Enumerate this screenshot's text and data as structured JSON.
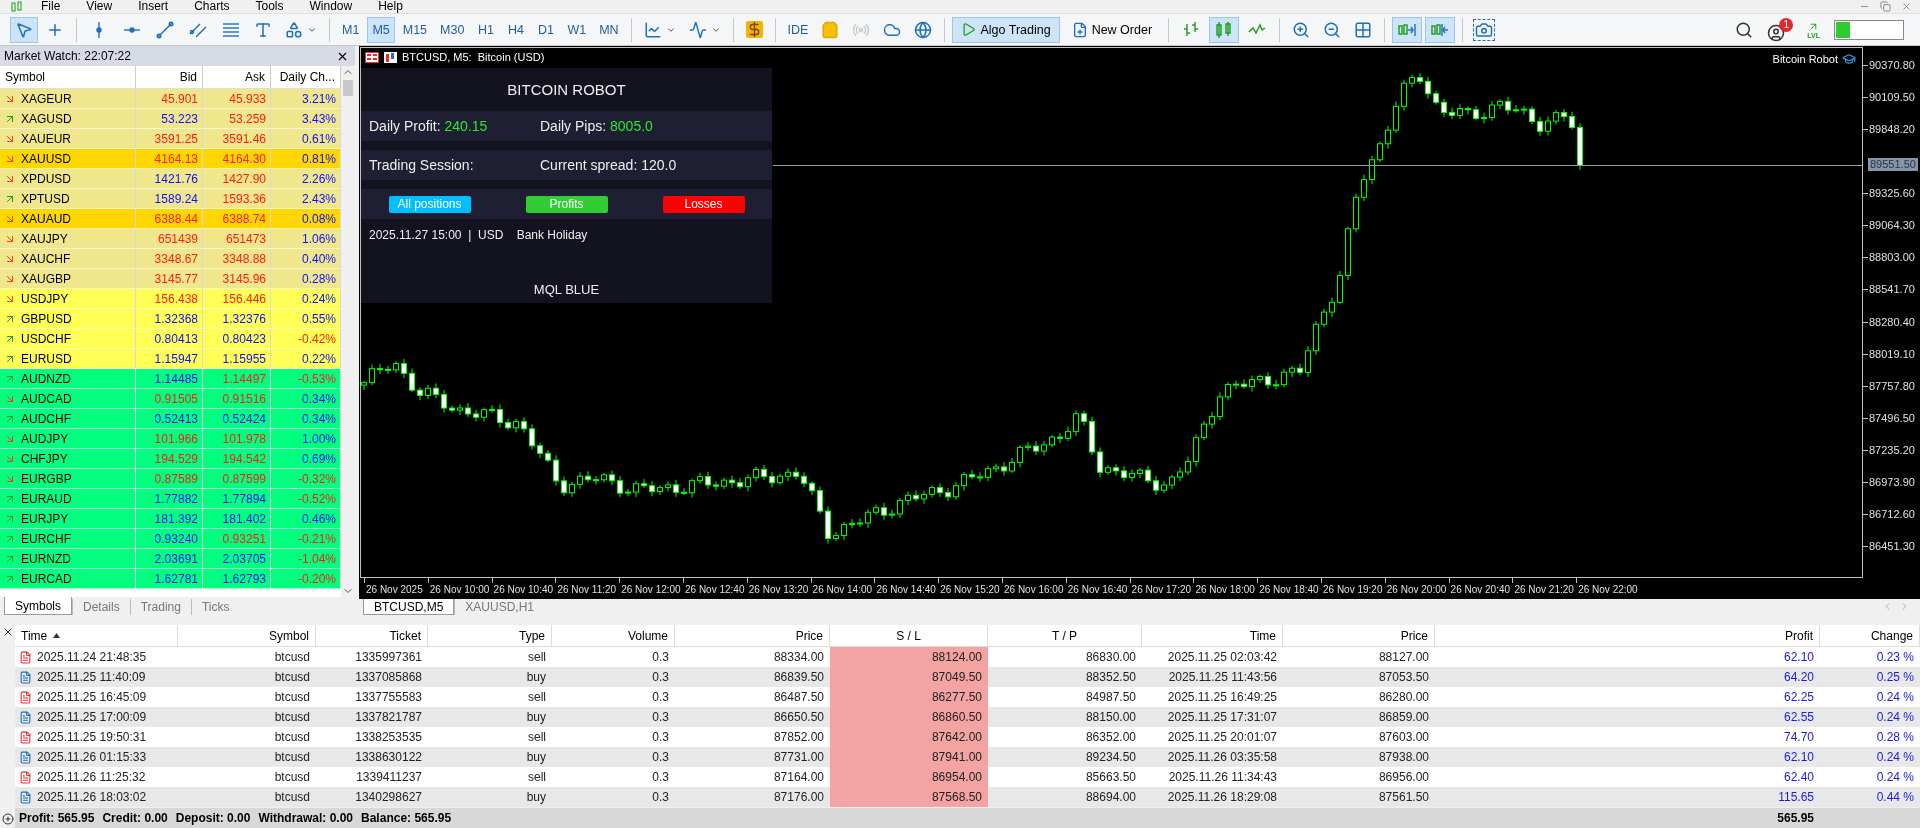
{
  "menu": {
    "items": [
      "File",
      "View",
      "Insert",
      "Charts",
      "Tools",
      "Window",
      "Help"
    ]
  },
  "toolbar": {
    "items": [
      {
        "kind": "icon",
        "pressed": true,
        "disabled": false
      },
      {
        "kind": "icon",
        "pressed": false,
        "disabled": false
      },
      {
        "kind": "separator"
      },
      {
        "kind": "icon",
        "pressed": false,
        "disabled": false
      },
      {
        "kind": "icon",
        "pressed": false,
        "disabled": false
      },
      {
        "kind": "icon",
        "pressed": false,
        "disabled": false
      },
      {
        "kind": "icon",
        "pressed": false,
        "disabled": false
      },
      {
        "kind": "icon",
        "pressed": false,
        "disabled": false
      },
      {
        "kind": "icon",
        "pressed": false,
        "disabled": false
      },
      {
        "kind": "icon",
        "pressed": false,
        "disabled": false
      },
      {
        "kind": "separator"
      },
      {
        "kind": "text",
        "label": "M1",
        "pressed": false
      },
      {
        "kind": "text",
        "label": "M5",
        "pressed": true
      },
      {
        "kind": "text",
        "label": "M15",
        "pressed": false
      },
      {
        "kind": "text",
        "label": "M30",
        "pressed": false
      },
      {
        "kind": "text",
        "label": "H1",
        "pressed": false
      },
      {
        "kind": "text",
        "label": "H4",
        "pressed": false
      },
      {
        "kind": "text",
        "label": "D1",
        "pressed": false
      },
      {
        "kind": "text",
        "label": "W1",
        "pressed": false
      },
      {
        "kind": "text",
        "label": "MN",
        "pressed": false
      },
      {
        "kind": "separator"
      },
      {
        "kind": "icon",
        "pressed": false,
        "disabled": false
      },
      {
        "kind": "icon",
        "pressed": false,
        "disabled": false
      },
      {
        "kind": "separator"
      },
      {
        "kind": "icon",
        "pressed": false,
        "disabled": false
      },
      {
        "kind": "separator"
      },
      {
        "kind": "text",
        "label": "IDE",
        "pressed": false
      },
      {
        "kind": "icon",
        "pressed": false,
        "disabled": false
      },
      {
        "kind": "icon",
        "pressed": false,
        "disabled": true
      },
      {
        "kind": "icon",
        "pressed": false,
        "disabled": false
      },
      {
        "kind": "icon",
        "pressed": false,
        "disabled": false
      },
      {
        "kind": "separator"
      },
      {
        "kind": "button",
        "label": "Algo Trading",
        "pressed": true
      },
      {
        "kind": "button",
        "label": "New Order",
        "pressed": false
      },
      {
        "kind": "separator"
      },
      {
        "kind": "icon",
        "pressed": false,
        "disabled": false
      },
      {
        "kind": "icon",
        "pressed": true,
        "disabled": false
      },
      {
        "kind": "icon",
        "pressed": false,
        "disabled": false
      },
      {
        "kind": "separator"
      },
      {
        "kind": "icon",
        "pressed": false,
        "disabled": false
      },
      {
        "kind": "icon",
        "pressed": false,
        "disabled": false
      },
      {
        "kind": "icon",
        "pressed": false,
        "disabled": false
      },
      {
        "kind": "separator"
      },
      {
        "kind": "icon",
        "pressed": true,
        "disabled": false
      },
      {
        "kind": "icon",
        "pressed": true,
        "disabled": false
      },
      {
        "kind": "separator"
      },
      {
        "kind": "icon",
        "pressed": false,
        "disabled": false
      }
    ],
    "notification_count": "1",
    "level_label": "LVL"
  },
  "market_watch": {
    "title": "Market Watch: 22:07:22",
    "columns": [
      "Symbol",
      "Bid",
      "Ask",
      "Daily Ch..."
    ],
    "rows": [
      {
        "symbol": "XAGEUR",
        "rising": false,
        "bid": "45.901",
        "bid_up": false,
        "ask": "45.933",
        "ask_up": false,
        "change": "3.21%",
        "change_up": true,
        "color": "#f0e68c"
      },
      {
        "symbol": "XAGUSD",
        "rising": true,
        "bid": "53.223",
        "bid_up": true,
        "ask": "53.259",
        "ask_up": false,
        "change": "3.43%",
        "change_up": true,
        "color": "#f0e68c"
      },
      {
        "symbol": "XAUEUR",
        "rising": false,
        "bid": "3591.25",
        "bid_up": false,
        "ask": "3591.46",
        "ask_up": false,
        "change": "0.61%",
        "change_up": true,
        "color": "#f0e68c"
      },
      {
        "symbol": "XAUUSD",
        "rising": false,
        "bid": "4164.13",
        "bid_up": false,
        "ask": "4164.30",
        "ask_up": false,
        "change": "0.81%",
        "change_up": true,
        "color": "#ffd700"
      },
      {
        "symbol": "XPDUSD",
        "rising": false,
        "bid": "1421.76",
        "bid_up": true,
        "ask": "1427.90",
        "ask_up": false,
        "change": "2.26%",
        "change_up": true,
        "color": "#f0e68c"
      },
      {
        "symbol": "XPTUSD",
        "rising": true,
        "bid": "1589.24",
        "bid_up": true,
        "ask": "1593.36",
        "ask_up": false,
        "change": "2.43%",
        "change_up": true,
        "color": "#f0e68c"
      },
      {
        "symbol": "XAUAUD",
        "rising": false,
        "bid": "6388.44",
        "bid_up": false,
        "ask": "6388.74",
        "ask_up": false,
        "change": "0.08%",
        "change_up": true,
        "color": "#ffd700"
      },
      {
        "symbol": "XAUJPY",
        "rising": false,
        "bid": "651439",
        "bid_up": false,
        "ask": "651473",
        "ask_up": false,
        "change": "1.06%",
        "change_up": true,
        "color": "#f0e68c"
      },
      {
        "symbol": "XAUCHF",
        "rising": false,
        "bid": "3348.67",
        "bid_up": false,
        "ask": "3348.88",
        "ask_up": false,
        "change": "0.40%",
        "change_up": true,
        "color": "#f0e68c"
      },
      {
        "symbol": "XAUGBP",
        "rising": false,
        "bid": "3145.77",
        "bid_up": false,
        "ask": "3145.96",
        "ask_up": false,
        "change": "0.28%",
        "change_up": true,
        "color": "#f0e68c"
      },
      {
        "symbol": "USDJPY",
        "rising": false,
        "bid": "156.438",
        "bid_up": false,
        "ask": "156.446",
        "ask_up": false,
        "change": "0.24%",
        "change_up": true,
        "color": "#ffff55"
      },
      {
        "symbol": "GBPUSD",
        "rising": true,
        "bid": "1.32368",
        "bid_up": true,
        "ask": "1.32376",
        "ask_up": true,
        "change": "0.55%",
        "change_up": true,
        "color": "#ffff55"
      },
      {
        "symbol": "USDCHF",
        "rising": true,
        "bid": "0.80413",
        "bid_up": true,
        "ask": "0.80423",
        "ask_up": true,
        "change": "-0.42%",
        "change_up": false,
        "color": "#ffff55"
      },
      {
        "symbol": "EURUSD",
        "rising": true,
        "bid": "1.15947",
        "bid_up": true,
        "ask": "1.15955",
        "ask_up": true,
        "change": "0.22%",
        "change_up": true,
        "color": "#ffff55"
      },
      {
        "symbol": "AUDNZD",
        "rising": true,
        "bid": "1.14485",
        "bid_up": true,
        "ask": "1.14497",
        "ask_up": false,
        "change": "-0.53%",
        "change_up": false,
        "color": "#00ff7f"
      },
      {
        "symbol": "AUDCAD",
        "rising": false,
        "bid": "0.91505",
        "bid_up": false,
        "ask": "0.91516",
        "ask_up": false,
        "change": "0.34%",
        "change_up": true,
        "color": "#00ff7f"
      },
      {
        "symbol": "AUDCHF",
        "rising": true,
        "bid": "0.52413",
        "bid_up": true,
        "ask": "0.52424",
        "ask_up": true,
        "change": "0.34%",
        "change_up": true,
        "color": "#00ff7f"
      },
      {
        "symbol": "AUDJPY",
        "rising": false,
        "bid": "101.966",
        "bid_up": false,
        "ask": "101.978",
        "ask_up": false,
        "change": "1.00%",
        "change_up": true,
        "color": "#00ff7f"
      },
      {
        "symbol": "CHFJPY",
        "rising": false,
        "bid": "194.529",
        "bid_up": false,
        "ask": "194.542",
        "ask_up": false,
        "change": "0.69%",
        "change_up": true,
        "color": "#00ff7f"
      },
      {
        "symbol": "EURGBP",
        "rising": false,
        "bid": "0.87589",
        "bid_up": false,
        "ask": "0.87599",
        "ask_up": false,
        "change": "-0.32%",
        "change_up": false,
        "color": "#00ff7f"
      },
      {
        "symbol": "EURAUD",
        "rising": true,
        "bid": "1.77882",
        "bid_up": true,
        "ask": "1.77894",
        "ask_up": true,
        "change": "-0.52%",
        "change_up": false,
        "color": "#00ff7f"
      },
      {
        "symbol": "EURJPY",
        "rising": true,
        "bid": "181.392",
        "bid_up": true,
        "ask": "181.402",
        "ask_up": true,
        "change": "0.46%",
        "change_up": true,
        "color": "#00ff7f"
      },
      {
        "symbol": "EURCHF",
        "rising": true,
        "bid": "0.93240",
        "bid_up": true,
        "ask": "0.93251",
        "ask_up": false,
        "change": "-0.21%",
        "change_up": false,
        "color": "#00ff7f"
      },
      {
        "symbol": "EURNZD",
        "rising": true,
        "bid": "2.03691",
        "bid_up": true,
        "ask": "2.03705",
        "ask_up": true,
        "change": "-1.04%",
        "change_up": false,
        "color": "#00ff7f"
      },
      {
        "symbol": "EURCAD",
        "rising": true,
        "bid": "1.62781",
        "bid_up": true,
        "ask": "1.62793",
        "ask_up": true,
        "change": "-0.20%",
        "change_up": false,
        "color": "#00ff7f"
      }
    ],
    "tabs": [
      {
        "label": "Symbols",
        "selected": true
      },
      {
        "label": "Details",
        "selected": false
      },
      {
        "label": "Trading",
        "selected": false
      },
      {
        "label": "Ticks",
        "selected": false
      }
    ]
  },
  "chart": {
    "header": "BTCUSD, M5:  Bitcoin (USD)",
    "expert": "Bitcoin Robot",
    "price_axis": [
      "90370.80",
      "90109.50",
      "89848.20",
      "89325.60",
      "89064.30",
      "88803.00",
      "88541.70",
      "88280.40",
      "88019.10",
      "87757.80",
      "87496.50",
      "87235.20",
      "86973.90",
      "86712.60",
      "86451.30"
    ],
    "current_price": "89551.50",
    "time_axis": [
      "26 Nov 2025",
      "26 Nov 10:00",
      "26 Nov 10:40",
      "26 Nov 11:20",
      "26 Nov 12:00",
      "26 Nov 12:40",
      "26 Nov 13:20",
      "26 Nov 14:00",
      "26 Nov 14:40",
      "26 Nov 15:20",
      "26 Nov 16:00",
      "26 Nov 16:40",
      "26 Nov 17:20",
      "26 Nov 18:00",
      "26 Nov 18:40",
      "26 Nov 19:20",
      "26 Nov 20:00",
      "26 Nov 20:40",
      "26 Nov 21:20",
      "26 Nov 22:00"
    ],
    "panel": {
      "title": "BITCOIN ROBOT",
      "rows": [
        [
          {
            "label": "Daily Profit:",
            "value": "240.15",
            "highlight": true
          },
          {
            "label": "Daily Pips:",
            "value": "8005.0",
            "highlight": true
          }
        ],
        [
          {
            "label": "Trading Session:"
          },
          {
            "label": "Current spread:",
            "value": "120.0",
            "highlight": false
          }
        ]
      ],
      "buttons": [
        {
          "label": "All positions",
          "color": "#00bfff"
        },
        {
          "label": "Profits",
          "color": "#32cd32"
        },
        {
          "label": "Losses",
          "color": "#ff0000"
        }
      ],
      "news": {
        "date": "2025.11.27 15:00",
        "separator": "|",
        "currency": "USD",
        "event": "Bank Holiday"
      },
      "footer": "MQL BLUE"
    },
    "tabs": [
      {
        "label": "BTCUSD,M5",
        "selected": true
      },
      {
        "label": "XAUUSD,H1",
        "selected": false
      }
    ]
  },
  "trades": {
    "columns": [
      "Time",
      "Symbol",
      "Ticket",
      "Type",
      "Volume",
      "Price",
      "S / L",
      "T / P",
      "Time",
      "Price",
      "Profit",
      "Change"
    ],
    "rows": [
      {
        "kind": "sell",
        "cells": [
          "2025.11.24 21:48:35",
          "btcusd",
          "1335997361",
          "sell",
          "0.3",
          "88334.00",
          "88124.00",
          "86830.00",
          "2025.11.25 02:03:42",
          "88127.00",
          "62.10",
          "0.23 %"
        ]
      },
      {
        "kind": "buy",
        "cells": [
          "2025.11.25 11:40:09",
          "btcusd",
          "1337085868",
          "buy",
          "0.3",
          "86839.50",
          "87049.50",
          "88352.50",
          "2025.11.25 11:43:56",
          "87053.50",
          "64.20",
          "0.25 %"
        ]
      },
      {
        "kind": "sell",
        "cells": [
          "2025.11.25 16:45:09",
          "btcusd",
          "1337755583",
          "sell",
          "0.3",
          "86487.50",
          "86277.50",
          "84987.50",
          "2025.11.25 16:49:25",
          "86280.00",
          "62.25",
          "0.24 %"
        ]
      },
      {
        "kind": "buy",
        "cells": [
          "2025.11.25 17:00:09",
          "btcusd",
          "1337821787",
          "buy",
          "0.3",
          "86650.50",
          "86860.50",
          "88150.00",
          "2025.11.25 17:31:07",
          "86859.00",
          "62.55",
          "0.24 %"
        ]
      },
      {
        "kind": "sell",
        "cells": [
          "2025.11.25 19:50:31",
          "btcusd",
          "1338253535",
          "sell",
          "0.3",
          "87852.00",
          "87642.00",
          "86352.00",
          "2025.11.25 20:01:07",
          "87603.00",
          "74.70",
          "0.28 %"
        ]
      },
      {
        "kind": "buy",
        "cells": [
          "2025.11.26 01:15:33",
          "btcusd",
          "1338630122",
          "buy",
          "0.3",
          "87731.00",
          "87941.00",
          "89234.50",
          "2025.11.26 03:35:58",
          "87938.00",
          "62.10",
          "0.24 %"
        ]
      },
      {
        "kind": "sell",
        "cells": [
          "2025.11.26 11:25:32",
          "btcusd",
          "1339411237",
          "sell",
          "0.3",
          "87164.00",
          "86954.00",
          "85663.50",
          "2025.11.26 11:34:43",
          "86956.00",
          "62.40",
          "0.24 %"
        ]
      },
      {
        "kind": "buy",
        "cells": [
          "2025.11.26 18:03:02",
          "btcusd",
          "1340298627",
          "buy",
          "0.3",
          "87176.00",
          "87568.50",
          "88694.00",
          "2025.11.26 18:29:08",
          "87561.50",
          "115.65",
          "0.44 %"
        ]
      }
    ],
    "summary": {
      "items": [
        "Profit: 565.95",
        "Credit: 0.00",
        "Deposit: 0.00",
        "Withdrawal: 0.00",
        "Balance: 565.95"
      ],
      "total": "565.95"
    }
  }
}
